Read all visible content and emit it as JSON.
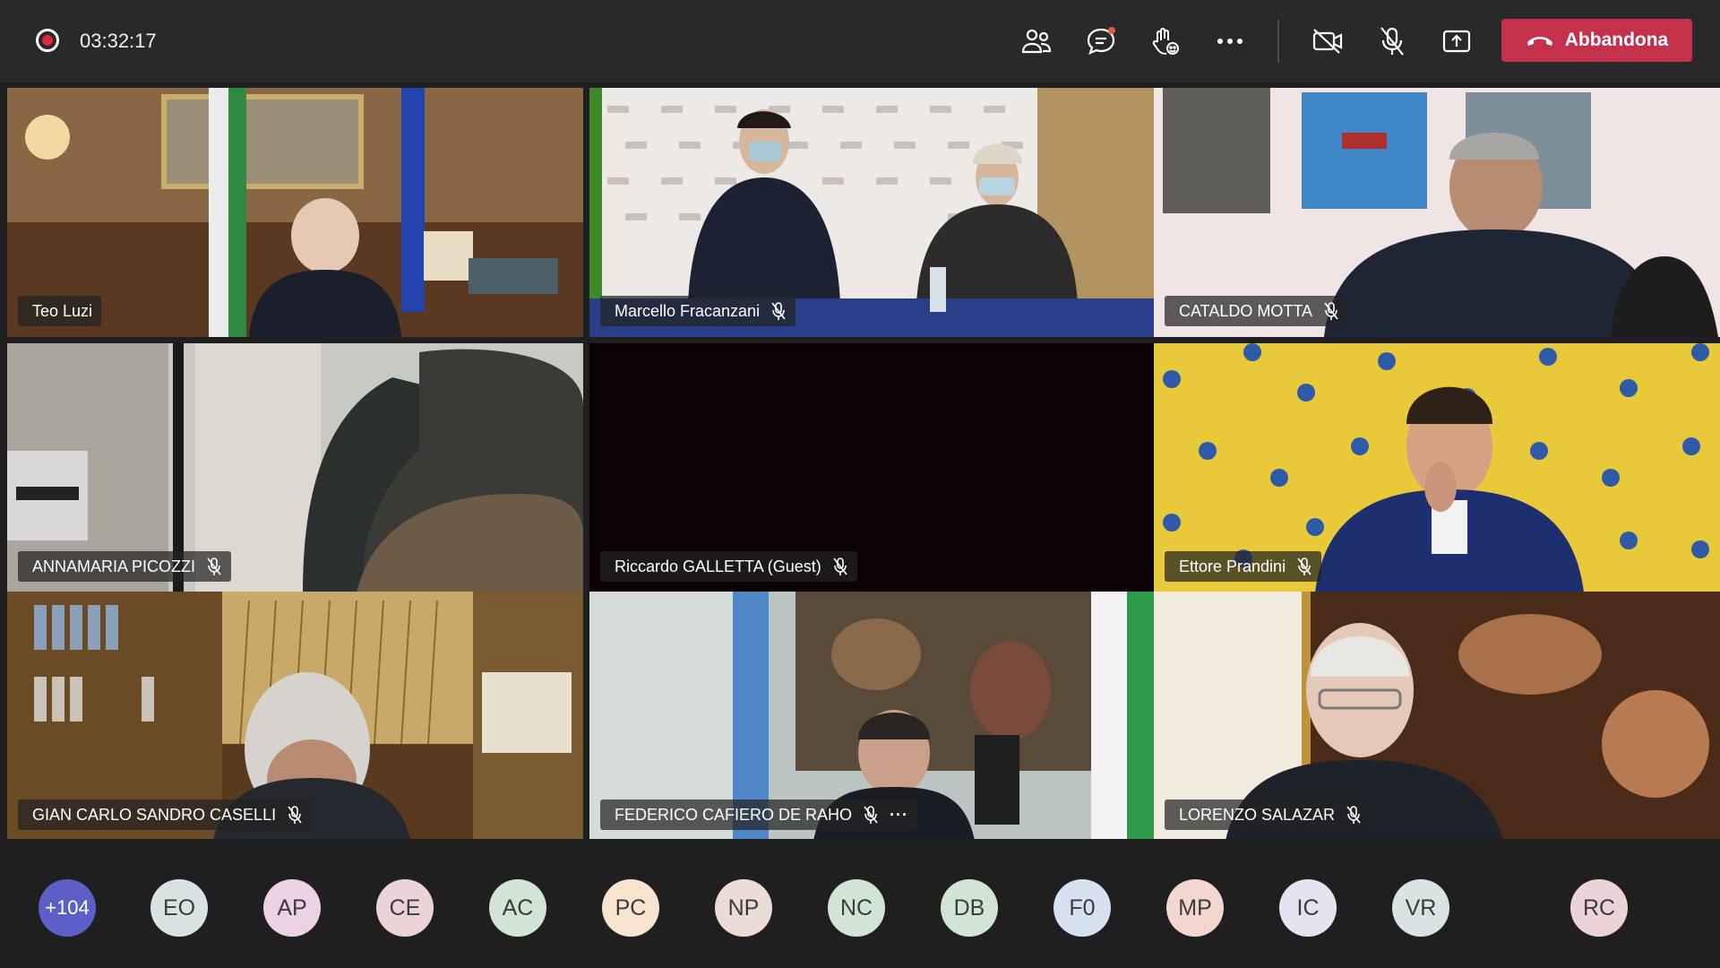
{
  "meeting": {
    "timer": "03:32:17",
    "leave_label": "Abbandona",
    "colors": {
      "leave_button": "#c4314b",
      "recording": "#e0293d",
      "more_badge": "#5b5fc7"
    }
  },
  "toolbar": {
    "icons": [
      "participants-icon",
      "chat-icon",
      "reactions-icon",
      "more-options-icon",
      "camera-off-icon",
      "mic-off-icon",
      "share-screen-icon",
      "hangup-icon"
    ]
  },
  "tiles": [
    {
      "name": "Teo Luzi",
      "muted": false
    },
    {
      "name": "Marcello Fracanzani",
      "muted": true
    },
    {
      "name": "CATALDO MOTTA",
      "muted": true
    },
    {
      "name": "ANNAMARIA PICOZZI",
      "muted": true
    },
    {
      "name": "Riccardo GALLETTA (Guest)",
      "muted": true
    },
    {
      "name": "Ettore Prandini",
      "muted": true
    },
    {
      "name": "GIAN CARLO SANDRO CASELLI",
      "muted": true
    },
    {
      "name": "FEDERICO CAFIERO DE RAHO",
      "muted": true,
      "more": "···"
    },
    {
      "name": "LORENZO SALAZAR",
      "muted": true
    }
  ],
  "participants": [
    {
      "initials": "+104",
      "color": "#5b5fc7"
    },
    {
      "initials": "EO",
      "color": "#d9e3e4"
    },
    {
      "initials": "AP",
      "color": "#ecd2e2"
    },
    {
      "initials": "CE",
      "color": "#ecd3d8"
    },
    {
      "initials": "AC",
      "color": "#d2e4d6"
    },
    {
      "initials": "PC",
      "color": "#f8e3cf"
    },
    {
      "initials": "NP",
      "color": "#ecdcd6"
    },
    {
      "initials": "NC",
      "color": "#d2e4d6"
    },
    {
      "initials": "DB",
      "color": "#d2e4d6"
    },
    {
      "initials": "F0",
      "color": "#d6e1f2"
    },
    {
      "initials": "MP",
      "color": "#f3d6cf"
    },
    {
      "initials": "IC",
      "color": "#e6e2f0"
    },
    {
      "initials": "VR",
      "color": "#d9e3e4"
    },
    {
      "initials": "RC",
      "color": "#ecd3d8"
    }
  ]
}
